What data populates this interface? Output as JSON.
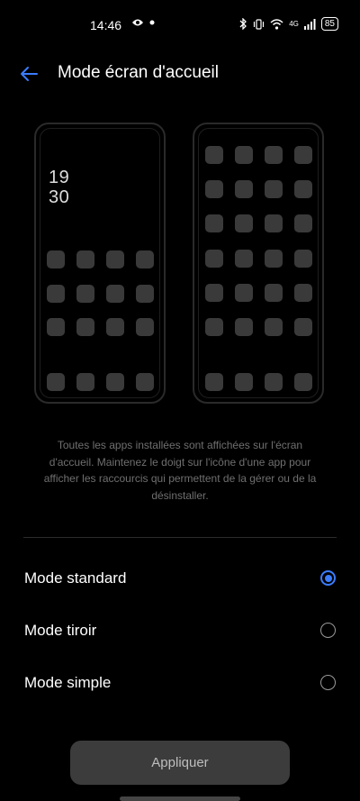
{
  "status_bar": {
    "time": "14:46",
    "network": "4G",
    "battery": "85",
    "icons": [
      "eye-icon",
      "dot-icon",
      "bluetooth-icon",
      "vibrate-icon",
      "wifi-icon",
      "signal-icon",
      "battery-icon"
    ]
  },
  "header": {
    "title": "Mode écran d'accueil",
    "back_icon": "arrow-left-icon"
  },
  "previews": {
    "standard": {
      "clock_hours": "19",
      "clock_minutes": "30"
    }
  },
  "description": "Toutes les apps installées sont affichées sur l'écran d'accueil. Maintenez le doigt sur l'icône d'une app pour afficher les raccourcis qui permettent de la gérer ou de la désinstaller.",
  "options": [
    {
      "label": "Mode standard",
      "selected": true
    },
    {
      "label": "Mode tiroir",
      "selected": false
    },
    {
      "label": "Mode simple",
      "selected": false
    }
  ],
  "apply_label": "Appliquer",
  "colors": {
    "accent": "#3b7cff",
    "background": "#000000",
    "text_muted": "#6f6f6f"
  }
}
